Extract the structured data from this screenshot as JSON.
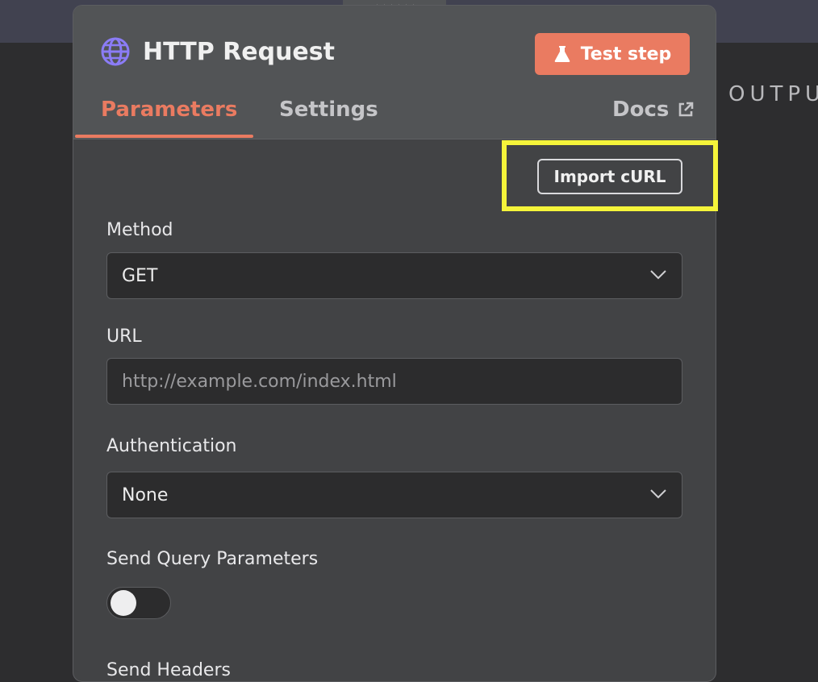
{
  "node": {
    "title": "HTTP Request"
  },
  "header": {
    "test_step_label": "Test step"
  },
  "tabs": [
    {
      "label": "Parameters",
      "active": true
    },
    {
      "label": "Settings",
      "active": false
    },
    {
      "label": "Docs",
      "active": false
    }
  ],
  "import_curl_label": "Import cURL",
  "output_label": "OUTPU",
  "fields": {
    "method": {
      "label": "Method",
      "value": "GET"
    },
    "url": {
      "label": "URL",
      "placeholder": "http://example.com/index.html",
      "value": ""
    },
    "authentication": {
      "label": "Authentication",
      "value": "None"
    },
    "send_query_parameters": {
      "label": "Send Query Parameters",
      "enabled": false
    },
    "next_label": "Send Headers"
  },
  "icons": [
    "globe-icon",
    "flask-icon",
    "external-link-icon",
    "chevron-down-icon",
    "drag-handle-icon"
  ],
  "colors": {
    "accent": "#ea7b61",
    "highlight": "#f5f43a",
    "globe": "#8b7cf6"
  }
}
